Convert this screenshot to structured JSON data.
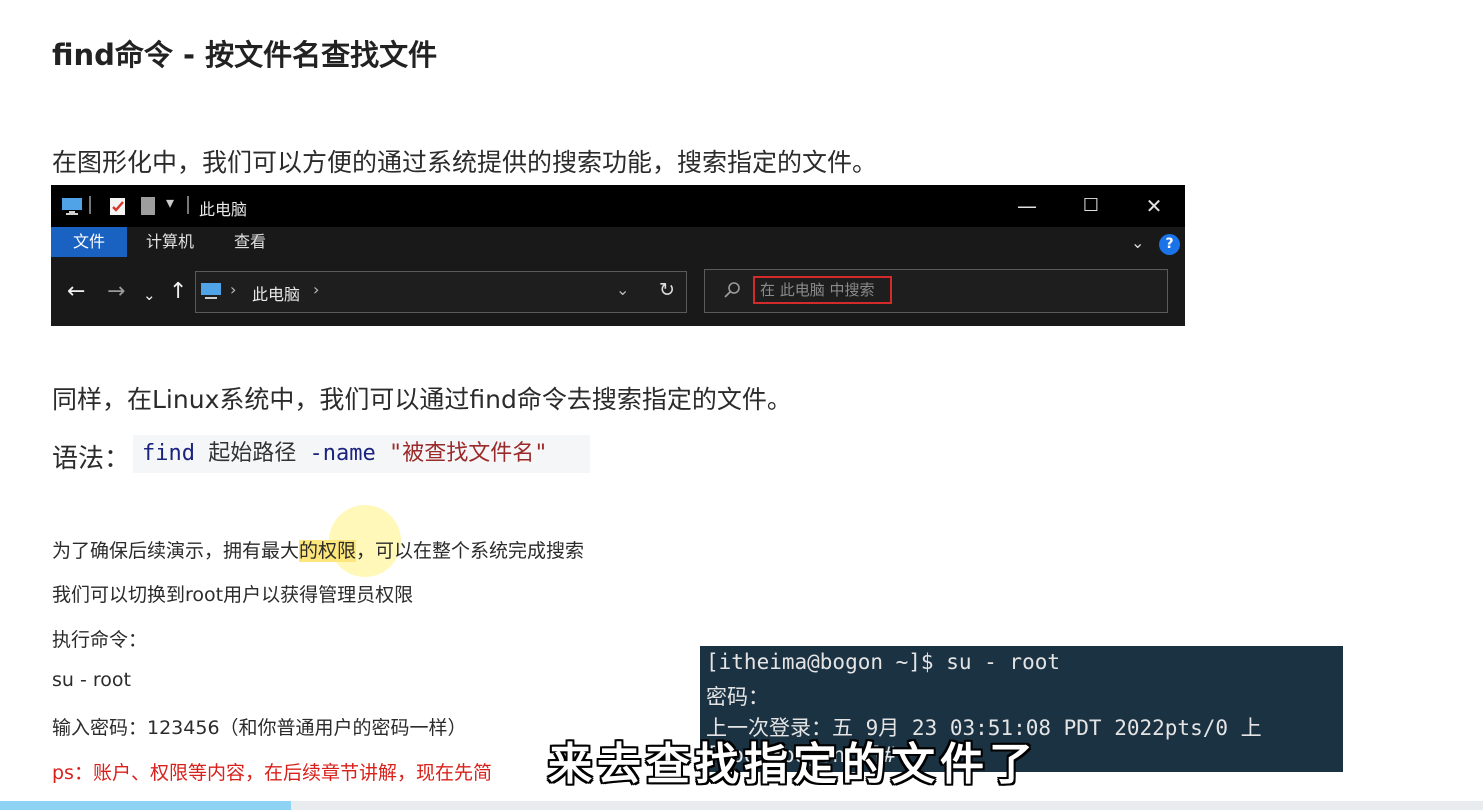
{
  "doc": {
    "title": "find命令 - 按文件名查找文件",
    "para1": "在图形化中，我们可以方便的通过系统提供的搜索功能，搜索指定的文件。",
    "para2": "同样，在Linux系统中，我们可以通过find命令去搜索指定的文件。",
    "syntax_label": "语法：",
    "syntax": {
      "cmd": "find",
      "arg": " 起始路径 ",
      "opt": "-name",
      "str": " \"被查找文件名\""
    },
    "note1_a": "为了确保后续演示，拥有最大",
    "note1_b": "的权限",
    "note1_c": "，可以在整个系统完成搜索",
    "note2": "我们可以切换到root用户以获得管理员权限",
    "note3": "执行命令：",
    "note4": "su - root",
    "note5": "输入密码：123456（和你普通用户的密码一样）",
    "note6": "ps：账户、权限等内容，在后续章节讲解，现在先简"
  },
  "explorer": {
    "window_title": "此电脑",
    "tabs": [
      "文件",
      "计算机",
      "查看"
    ],
    "address": "此电脑",
    "search_placeholder": "在 此电脑 中搜索",
    "controls": {
      "minimize": "—",
      "maximize": "☐",
      "close": "✕"
    },
    "colors": {
      "accent": "#1a62c1",
      "search_highlight": "#d42a2a"
    }
  },
  "terminal": {
    "lines": [
      "[itheima@bogon ~]$ su - root",
      "密码：",
      "上一次登录：五 9月  23 03:51:08 PDT 2022pts/0 上",
      "[root@bogon ~]#"
    ]
  },
  "caption": "来去查找指定的文件了",
  "video_progress": 0.196
}
